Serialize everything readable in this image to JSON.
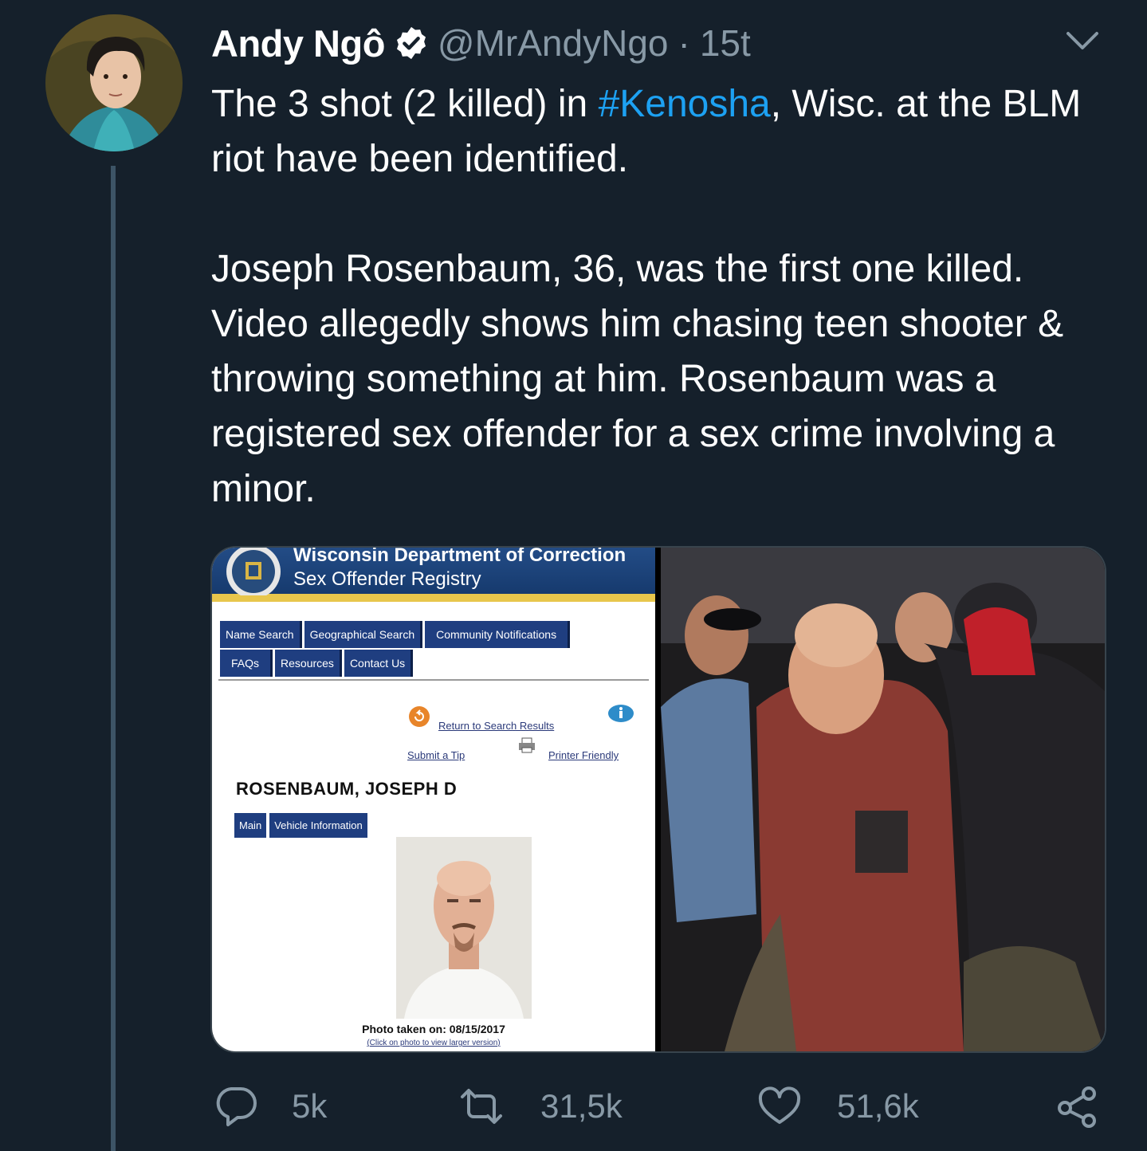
{
  "tweet": {
    "author_name": "Andy Ngô",
    "handle": "@MrAndyNgo",
    "separator": "·",
    "time": "15t",
    "text_line1_before": "The 3 shot (2 killed) in ",
    "hashtag": "#Kenosha",
    "text_line1_after": ", Wisc. at the BLM riot have been identified.",
    "paragraph2": "Joseph Rosenbaum, 36, was the first one killed. Video allegedly shows him chasing teen shooter & throwing something at him. Rosenbaum was a registered sex offender for a sex crime involving a minor."
  },
  "registry": {
    "title1": "Wisconsin Department of Correction",
    "title2": "Sex Offender Registry",
    "nav1": [
      "Name Search",
      "Geographical Search",
      "Community Notifications"
    ],
    "nav2": [
      "FAQs",
      "Resources",
      "Contact Us"
    ],
    "return_link": "Return to Search Results",
    "submit_tip": "Submit a Tip",
    "printer_friendly": "Printer Friendly",
    "person_name": "ROSENBAUM, JOSEPH D",
    "tabs": [
      "Main",
      "Vehicle Information"
    ],
    "photo_caption": "Photo taken on: 08/15/2017",
    "photo_hint": "(Click on photo to view larger version)"
  },
  "actions": {
    "replies": "5k",
    "retweets": "31,5k",
    "likes": "51,6k"
  },
  "icons": {
    "verified": "verified-badge-icon",
    "more": "chevron-down-icon",
    "reply": "reply-icon",
    "retweet": "retweet-icon",
    "like": "heart-icon",
    "share": "share-icon"
  },
  "colors": {
    "background": "#15202b",
    "link": "#1da1f2",
    "muted": "#8899a6"
  }
}
